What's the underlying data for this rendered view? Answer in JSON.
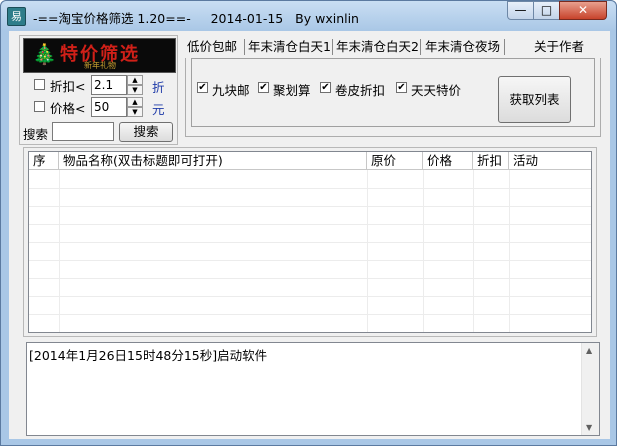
{
  "window": {
    "title": "-==淘宝价格筛选 1.20==-     2014-01-15   By wxinlin",
    "app_icon_glyph": "易",
    "minimize_glyph": "—",
    "maximize_glyph": "□",
    "close_glyph": "✕"
  },
  "logo": {
    "text": "特价筛选",
    "subtext": "新年礼物",
    "tree_glyph": "🎄"
  },
  "filters": {
    "discount": {
      "label": "折扣<",
      "value": "2.1",
      "unit": "折",
      "checked": false
    },
    "price": {
      "label": "价格<",
      "value": "50",
      "unit": "元",
      "checked": false
    },
    "search_label": "搜索",
    "search_value": "",
    "search_button": "搜索"
  },
  "tabs": [
    {
      "label": "低价包邮"
    },
    {
      "label": "年末清仓白天1"
    },
    {
      "label": "年末清仓白天2"
    },
    {
      "label": "年末清仓夜场"
    }
  ],
  "about_label": "关于作者",
  "sources": [
    {
      "label": "九块邮",
      "checked": true
    },
    {
      "label": "聚划算",
      "checked": true
    },
    {
      "label": "卷皮折扣",
      "checked": true
    },
    {
      "label": "天天特价",
      "checked": true
    }
  ],
  "fetch_button": "获取列表",
  "table": {
    "columns": [
      "序",
      "物品名称(双击标题即可打开)",
      "原价",
      "价格",
      "折扣",
      "活动"
    ],
    "rows": []
  },
  "log": {
    "text": "[2014年1月26日15时48分15秒]启动软件"
  },
  "icons": {
    "checkbox_checked": "✔",
    "spin_up": "▲",
    "spin_down": "▼"
  }
}
